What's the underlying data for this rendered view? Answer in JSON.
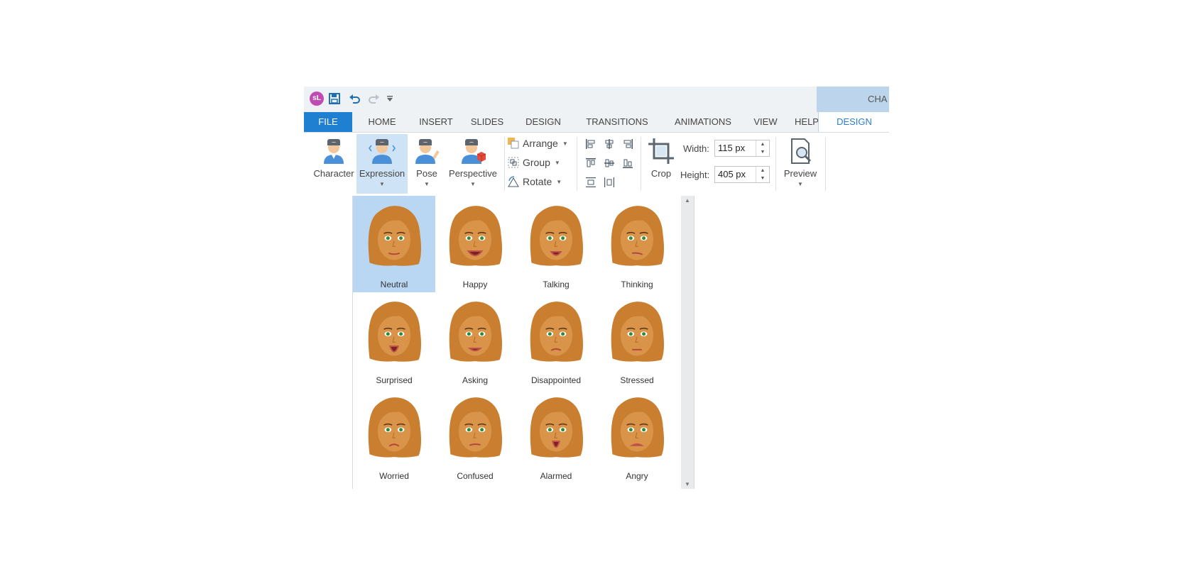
{
  "app": {
    "logo": "sL",
    "context_title": "CHA"
  },
  "quick_access": [
    {
      "icon": "save-icon"
    },
    {
      "icon": "undo-icon"
    },
    {
      "icon": "redo-icon"
    },
    {
      "icon": "customize-quick-access-icon"
    }
  ],
  "tabs": [
    "FILE",
    "HOME",
    "INSERT",
    "SLIDES",
    "DESIGN",
    "TRANSITIONS",
    "ANIMATIONS",
    "VIEW",
    "HELP"
  ],
  "context_tab": "DESIGN",
  "ribbon": {
    "character": "Character",
    "expression": "Expression",
    "pose": "Pose",
    "perspective": "Perspective",
    "arrange": "Arrange",
    "group": "Group",
    "rotate": "Rotate",
    "crop": "Crop",
    "width_label": "Width:",
    "width_value": "115 px",
    "height_label": "Height:",
    "height_value": "405 px",
    "preview": "Preview"
  },
  "expressions": [
    "Neutral",
    "Happy",
    "Talking",
    "Thinking",
    "Surprised",
    "Asking",
    "Disappointed",
    "Stressed",
    "Worried",
    "Confused",
    "Alarmed",
    "Angry"
  ],
  "selected_expression": "Neutral",
  "colors": {
    "accent": "#1f7fd1",
    "selection": "#b9d6f2",
    "hair": "#c97f2f",
    "skin": "#d9944a"
  }
}
